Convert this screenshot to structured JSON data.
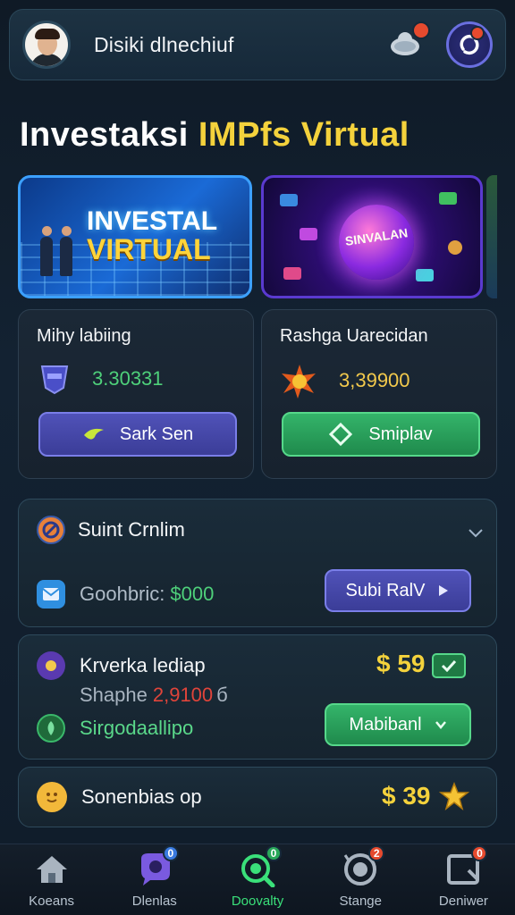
{
  "header": {
    "username": "Disiki dlnechiuf",
    "chat_badge": "",
    "sync_badge": ""
  },
  "title": {
    "part1": "Investaksi",
    "part2": "IMPfs",
    "part3": "Virtual"
  },
  "banners": [
    {
      "line1": "INVESTAL",
      "line2": "VIRTUAL"
    },
    {
      "label": "SINVALAN"
    }
  ],
  "cards": [
    {
      "label": "Mihy labiing",
      "value": "3.30331",
      "button": "Sark Sen",
      "value_color": "#4ed07a"
    },
    {
      "label": "Rashga Uarecidan",
      "value": "3,39900",
      "button": "Smiplav",
      "value_color": "#f2c94c"
    }
  ],
  "panel1": {
    "title": "Suint Crnlim",
    "row_label": "Goohbric:",
    "row_value": "$000",
    "button": "Subi RalV"
  },
  "panel2": {
    "title": "Krverka lediap",
    "amount": "$ 59",
    "sub_label": "Shaphe",
    "sub_value": "2,9100",
    "sub_suffix": "б",
    "row_label": "Sirgodaallipo",
    "button": "Mabibanl"
  },
  "panel3": {
    "title": "Sonenbias op",
    "amount": "$ 39"
  },
  "nav": [
    {
      "label": "Koeans",
      "badge": ""
    },
    {
      "label": "Dlenlas",
      "badge": "0"
    },
    {
      "label": "Doovalty",
      "badge": "0"
    },
    {
      "label": "Stange",
      "badge": "2"
    },
    {
      "label": "Deniwer",
      "badge": "0"
    }
  ],
  "colors": {
    "accent_yellow": "#f4d23c",
    "accent_green": "#34b46a",
    "accent_purple": "#5052b8",
    "badge_red": "#e64a2e"
  }
}
